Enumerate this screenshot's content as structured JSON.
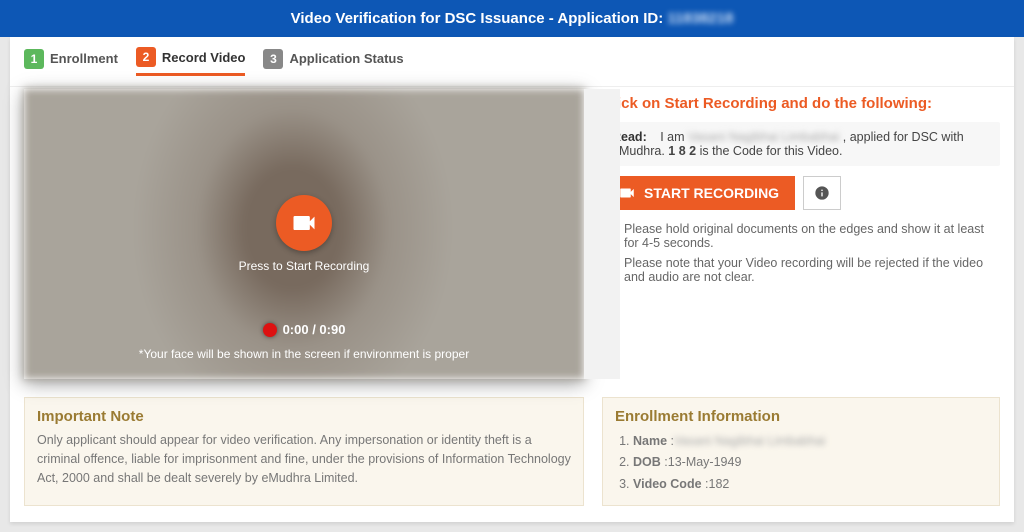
{
  "header": {
    "title_prefix": "Video Verification for DSC Issuance - Application ID: ",
    "application_id": "11838218"
  },
  "steps": [
    {
      "num": "1",
      "label": "Enrollment",
      "badge": "bg-green",
      "active": false
    },
    {
      "num": "2",
      "label": "Record Video",
      "badge": "bg-orange",
      "active": true
    },
    {
      "num": "3",
      "label": "Application Status",
      "badge": "bg-gray",
      "active": false
    }
  ],
  "video": {
    "press_label": "Press to Start Recording",
    "timer": "0:00 / 0:90",
    "face_note": "*Your face will be shown in the screen if environment is proper"
  },
  "instructions": {
    "title": "Click on Start Recording and do the following:",
    "read_label": "Read:",
    "read_prefix": "I am ",
    "read_name": "Vasani Nagibhai Limbabhai",
    "read_mid": ", applied for DSC with eMudhra. ",
    "read_code": "1 8 2",
    "read_suffix": " is the Code for this Video.",
    "start_button": "START RECORDING",
    "bullets": [
      "Please hold original documents on the edges and show it at least for 4-5 seconds.",
      "Please note that your Video recording will be rejected if the video and audio are not clear."
    ]
  },
  "important_note": {
    "title": "Important Note",
    "body": "Only applicant should appear for video verification. Any impersonation or identity theft is a criminal offence, liable for imprisonment and fine, under the provisions of Information Technology Act, 2000 and shall be dealt severely by eMudhra Limited."
  },
  "enrollment_info": {
    "title": "Enrollment Information",
    "name_label": "Name",
    "name_value": "Vasani Nagibhai Limbabhai",
    "dob_label": "DOB",
    "dob_value": "13-May-1949",
    "code_label": "Video Code",
    "code_value": "182"
  }
}
